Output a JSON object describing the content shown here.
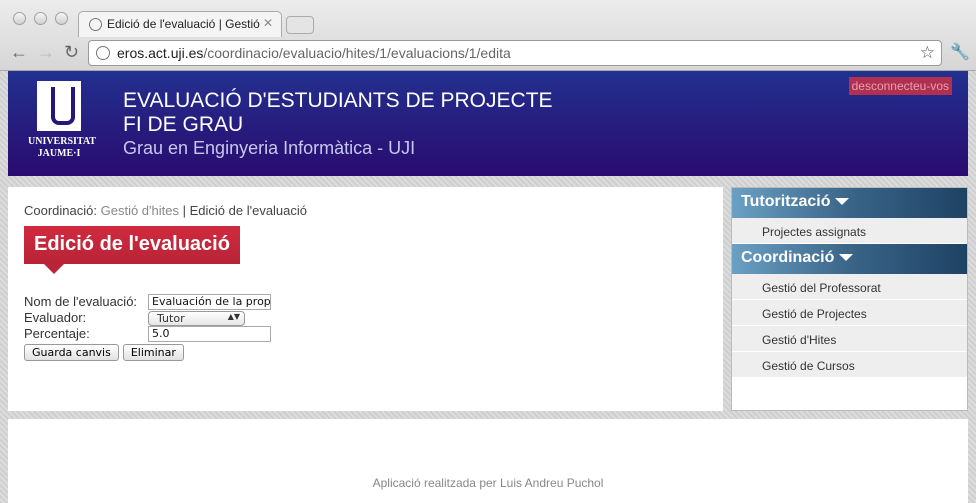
{
  "browser": {
    "tab_title": "Edició de l'evaluació | Gestió",
    "url_domain": "eros.act.uji.es",
    "url_path": "/coordinacio/evaluacio/hites/1/evaluacions/1/edita"
  },
  "header": {
    "logo_text_1": "UNIVERSITAT",
    "logo_text_2": "JAUME·I",
    "title_line1": "EVALUACIÓ D'ESTUDIANTS DE PROJECTE",
    "title_line2": "FI DE GRAU",
    "subtitle": "Grau en Enginyeria Informàtica - UJI",
    "logout": "desconnecteu-vos"
  },
  "breadcrumb": {
    "prefix": "Coordinació:",
    "link": "Gestió d'hites",
    "sep": "|",
    "current": "Edició de l'evaluació"
  },
  "page_title": "Edició de l'evaluació",
  "form": {
    "name_label": "Nom de l'evaluació:",
    "name_value": "Evaluación de la propuesta",
    "evaluator_label": "Evaluador:",
    "evaluator_value": "Tutor",
    "percent_label": "Percentaje:",
    "percent_value": "5.0",
    "save": "Guarda canvis",
    "delete": "Eliminar"
  },
  "sidebar": {
    "sections": [
      {
        "title": "Tutorització",
        "items": [
          "Projectes assignats"
        ]
      },
      {
        "title": "Coordinació",
        "items": [
          "Gestió del Professorat",
          "Gestió de Projectes",
          "Gestió d'Hites",
          "Gestió de Cursos"
        ]
      }
    ]
  },
  "footer": "Aplicació realitzada per Luis Andreu Puchol"
}
